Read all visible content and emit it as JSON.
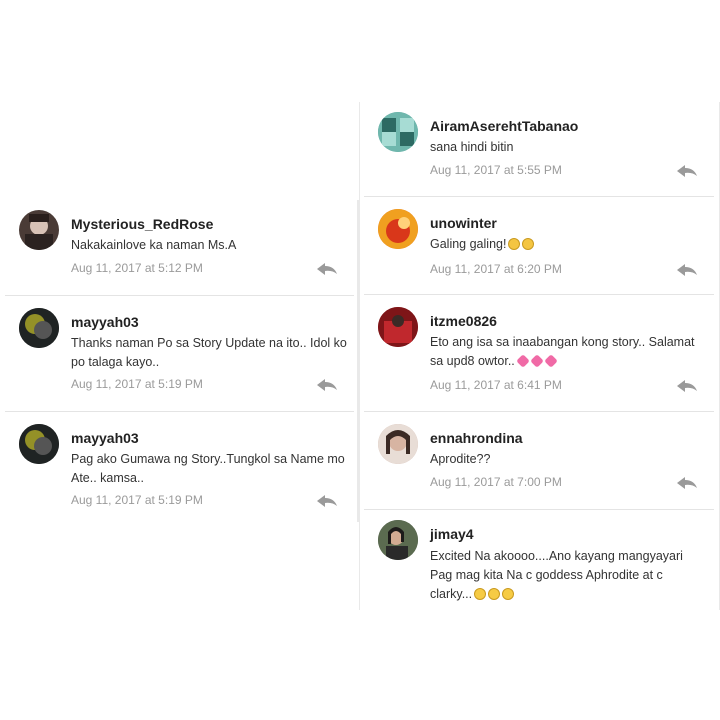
{
  "left_comments": [
    {
      "username": "Mysterious_RedRose",
      "text": "Nakakainlove ka naman Ms.A",
      "time": "Aug 11, 2017 at 5:12 PM",
      "avatar_color": "#4a3b36"
    },
    {
      "username": "mayyah03",
      "text": "Thanks naman Po sa Story Update na ito.. Idol ko po talaga kayo..",
      "time": "Aug 11, 2017 at 5:19 PM",
      "avatar_color": "#2f3333"
    },
    {
      "username": "mayyah03",
      "text": "Pag ako Gumawa ng Story..Tungkol sa Name mo Ate.. kamsa..",
      "time": "Aug 11, 2017 at 5:19 PM",
      "avatar_color": "#2f3333"
    }
  ],
  "right_comments": [
    {
      "username": "AiramAserehtTabanao",
      "text": "sana hindi bitin",
      "time": "Aug 11, 2017 at 5:55 PM",
      "avatar_color": "#5aa39a"
    },
    {
      "username": "unowinter",
      "text": "Galing galing!",
      "emoji": "😁😁",
      "time": "Aug 11, 2017 at 6:20 PM",
      "avatar_color": "#e2591c"
    },
    {
      "username": "itzme0826",
      "text": "Eto ang isa sa inaabangan kong story.. Salamat sa upd8 owtor..",
      "emoji": "💖💖💖",
      "time": "Aug 11, 2017 at 6:41 PM",
      "avatar_color": "#9c1f22"
    },
    {
      "username": "ennahrondina",
      "text": "Aprodite??",
      "time": "Aug 11, 2017 at 7:00 PM",
      "avatar_color": "#c9a89a"
    },
    {
      "username": "jimay4",
      "text": "Excited Na akoooo....Ano kayang mangyayari Pag mag kita Na c goddess Aphrodite at c clarky...",
      "emoji": "🤔🤔🤔",
      "time": "",
      "avatar_color": "#3f4a3a"
    }
  ],
  "colors": {
    "text": "#333333",
    "username": "#222222",
    "time": "#9a9a9a",
    "divider": "#e4e4e4",
    "reply_icon": "#9a9a9a"
  }
}
